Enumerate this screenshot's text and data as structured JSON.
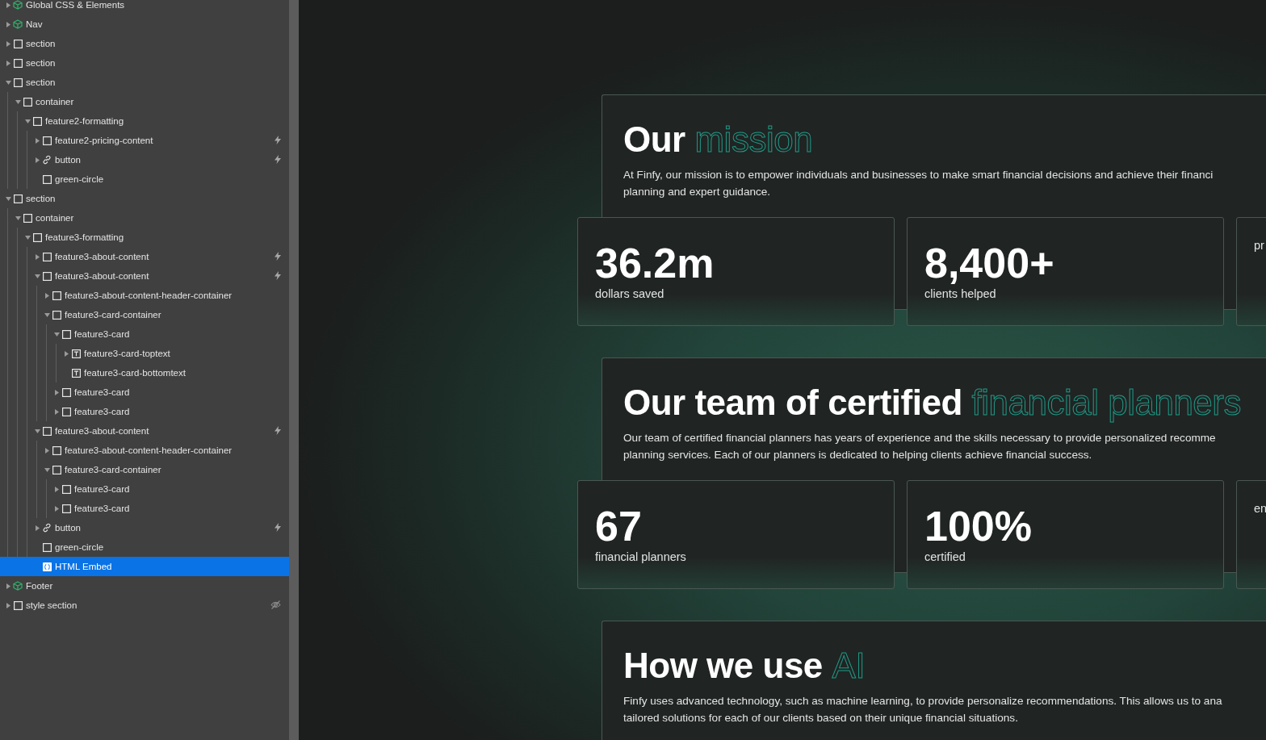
{
  "navigator": {
    "items": [
      {
        "label": "Global CSS & Elements",
        "kind": "component",
        "expandable": true,
        "expanded": false,
        "selected": false,
        "interaction": false,
        "hidden": false
      },
      {
        "label": "Nav",
        "kind": "component",
        "expandable": true,
        "expanded": false,
        "selected": false,
        "interaction": false,
        "hidden": false
      },
      {
        "label": "section",
        "kind": "box",
        "expandable": true,
        "expanded": false,
        "selected": false,
        "interaction": false,
        "hidden": false
      },
      {
        "label": "section",
        "kind": "box",
        "expandable": true,
        "expanded": false,
        "selected": false,
        "interaction": false,
        "hidden": false
      },
      {
        "label": "section",
        "kind": "box",
        "expandable": true,
        "expanded": true,
        "selected": false,
        "interaction": false,
        "hidden": false,
        "children": [
          {
            "label": "container",
            "kind": "box",
            "expandable": true,
            "expanded": true,
            "selected": false,
            "interaction": false,
            "hidden": false,
            "children": [
              {
                "label": "feature2-formatting",
                "kind": "box",
                "expandable": true,
                "expanded": true,
                "selected": false,
                "interaction": false,
                "hidden": false,
                "children": [
                  {
                    "label": "feature2-pricing-content",
                    "kind": "box",
                    "expandable": true,
                    "expanded": false,
                    "selected": false,
                    "interaction": true,
                    "hidden": false
                  },
                  {
                    "label": "button",
                    "kind": "link",
                    "expandable": true,
                    "expanded": false,
                    "selected": false,
                    "interaction": true,
                    "hidden": false
                  },
                  {
                    "label": "green-circle",
                    "kind": "box",
                    "expandable": false,
                    "expanded": false,
                    "selected": false,
                    "interaction": false,
                    "hidden": false
                  }
                ]
              }
            ]
          }
        ]
      },
      {
        "label": "section",
        "kind": "box",
        "expandable": true,
        "expanded": true,
        "selected": false,
        "interaction": false,
        "hidden": false,
        "children": [
          {
            "label": "container",
            "kind": "box",
            "expandable": true,
            "expanded": true,
            "selected": false,
            "interaction": false,
            "hidden": false,
            "children": [
              {
                "label": "feature3-formatting",
                "kind": "box",
                "expandable": true,
                "expanded": true,
                "selected": false,
                "interaction": false,
                "hidden": false,
                "children": [
                  {
                    "label": "feature3-about-content",
                    "kind": "box",
                    "expandable": true,
                    "expanded": false,
                    "selected": false,
                    "interaction": true,
                    "hidden": false
                  },
                  {
                    "label": "feature3-about-content",
                    "kind": "box",
                    "expandable": true,
                    "expanded": true,
                    "selected": false,
                    "interaction": true,
                    "hidden": false,
                    "children": [
                      {
                        "label": "feature3-about-content-header-container",
                        "kind": "box",
                        "expandable": true,
                        "expanded": false,
                        "selected": false,
                        "interaction": false,
                        "hidden": false
                      },
                      {
                        "label": "feature3-card-container",
                        "kind": "box",
                        "expandable": true,
                        "expanded": true,
                        "selected": false,
                        "interaction": false,
                        "hidden": false,
                        "children": [
                          {
                            "label": "feature3-card",
                            "kind": "box",
                            "expandable": true,
                            "expanded": true,
                            "selected": false,
                            "interaction": false,
                            "hidden": false,
                            "children": [
                              {
                                "label": "feature3-card-toptext",
                                "kind": "text",
                                "expandable": true,
                                "expanded": false,
                                "selected": false,
                                "interaction": false,
                                "hidden": false
                              },
                              {
                                "label": "feature3-card-bottomtext",
                                "kind": "text",
                                "expandable": false,
                                "expanded": false,
                                "selected": false,
                                "interaction": false,
                                "hidden": false
                              }
                            ]
                          },
                          {
                            "label": "feature3-card",
                            "kind": "box",
                            "expandable": true,
                            "expanded": false,
                            "selected": false,
                            "interaction": false,
                            "hidden": false
                          },
                          {
                            "label": "feature3-card",
                            "kind": "box",
                            "expandable": true,
                            "expanded": false,
                            "selected": false,
                            "interaction": false,
                            "hidden": false
                          }
                        ]
                      }
                    ]
                  },
                  {
                    "label": "feature3-about-content",
                    "kind": "box",
                    "expandable": true,
                    "expanded": true,
                    "selected": false,
                    "interaction": true,
                    "hidden": false,
                    "children": [
                      {
                        "label": "feature3-about-content-header-container",
                        "kind": "box",
                        "expandable": true,
                        "expanded": false,
                        "selected": false,
                        "interaction": false,
                        "hidden": false
                      },
                      {
                        "label": "feature3-card-container",
                        "kind": "box",
                        "expandable": true,
                        "expanded": true,
                        "selected": false,
                        "interaction": false,
                        "hidden": false,
                        "children": [
                          {
                            "label": "feature3-card",
                            "kind": "box",
                            "expandable": true,
                            "expanded": false,
                            "selected": false,
                            "interaction": false,
                            "hidden": false
                          },
                          {
                            "label": "feature3-card",
                            "kind": "box",
                            "expandable": true,
                            "expanded": false,
                            "selected": false,
                            "interaction": false,
                            "hidden": false
                          }
                        ]
                      }
                    ]
                  },
                  {
                    "label": "button",
                    "kind": "link",
                    "expandable": true,
                    "expanded": false,
                    "selected": false,
                    "interaction": true,
                    "hidden": false
                  },
                  {
                    "label": "green-circle",
                    "kind": "box",
                    "expandable": false,
                    "expanded": false,
                    "selected": false,
                    "interaction": false,
                    "hidden": false
                  },
                  {
                    "label": "HTML Embed",
                    "kind": "embed",
                    "expandable": false,
                    "expanded": false,
                    "selected": true,
                    "interaction": false,
                    "hidden": false
                  }
                ]
              }
            ]
          }
        ]
      },
      {
        "label": "Footer",
        "kind": "component",
        "expandable": true,
        "expanded": false,
        "selected": false,
        "interaction": false,
        "hidden": false
      },
      {
        "label": "style section",
        "kind": "box",
        "expandable": true,
        "expanded": false,
        "selected": false,
        "interaction": false,
        "hidden": true
      }
    ]
  },
  "canvas": {
    "sections": [
      {
        "heading": "Our",
        "accent": "mission",
        "paragraph_lines": [
          "At Finfy, our mission is to empower individuals and businesses to make smart financial decisions and achieve their financi",
          "planning and expert guidance."
        ],
        "stats": [
          {
            "value": "36.2m",
            "label": "dollars saved"
          },
          {
            "value": "8,400+",
            "label": "clients helped"
          },
          {
            "label": "pr"
          }
        ]
      },
      {
        "heading": "Our team of certified",
        "accent": "financial planners",
        "paragraph_lines": [
          "Our team of certified financial planners has years of experience and the skills necessary to provide personalized recomme",
          "planning services. Each of our planners is dedicated to helping clients achieve financial success."
        ],
        "stats": [
          {
            "value": "67",
            "label": "financial planners"
          },
          {
            "value": "100%",
            "label": "certified"
          },
          {
            "label": "en"
          }
        ]
      },
      {
        "heading": "How we use",
        "accent": "AI",
        "paragraph_lines": [
          "Finfy uses advanced technology, such as machine learning, to provide personalize recommendations. This allows us to ana",
          "tailored solutions for each of our clients based on their unique financial situations."
        ]
      }
    ]
  }
}
